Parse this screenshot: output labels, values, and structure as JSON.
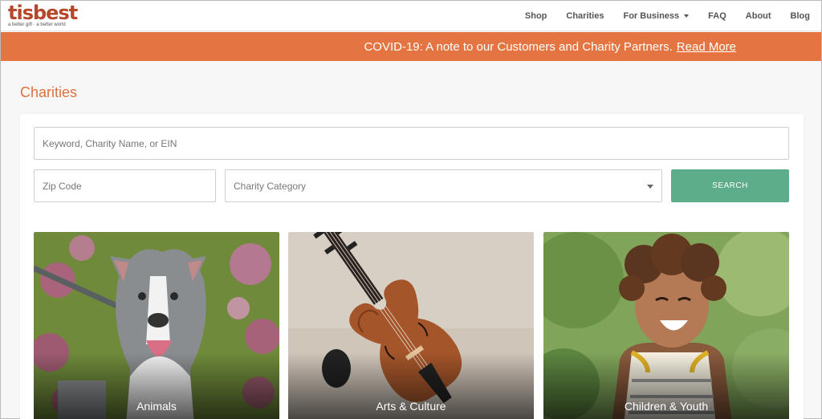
{
  "logo": {
    "name": "tisbest",
    "tagline": "a better gift · a better world"
  },
  "nav": {
    "items": [
      {
        "label": "Shop"
      },
      {
        "label": "Charities"
      },
      {
        "label": "For Business",
        "dropdown": true
      },
      {
        "label": "FAQ"
      },
      {
        "label": "About"
      },
      {
        "label": "Blog"
      }
    ]
  },
  "banner": {
    "text": "COVID-19: A note to our Customers and Charity Partners.",
    "link": "Read More",
    "color": "#e47542"
  },
  "page": {
    "title": "Charities"
  },
  "search": {
    "keyword_placeholder": "Keyword, Charity Name, or EIN",
    "zip_placeholder": "Zip Code",
    "category_value": "Charity Category",
    "button_label": "SEARCH",
    "button_color": "#5dac8a"
  },
  "categories": [
    {
      "label": "Animals",
      "image": "dog-photo"
    },
    {
      "label": "Arts & Culture",
      "image": "violin-photo"
    },
    {
      "label": "Children & Youth",
      "image": "child-photo"
    }
  ],
  "colors": {
    "accent": "#e0703f",
    "logo": "#b5472b"
  }
}
